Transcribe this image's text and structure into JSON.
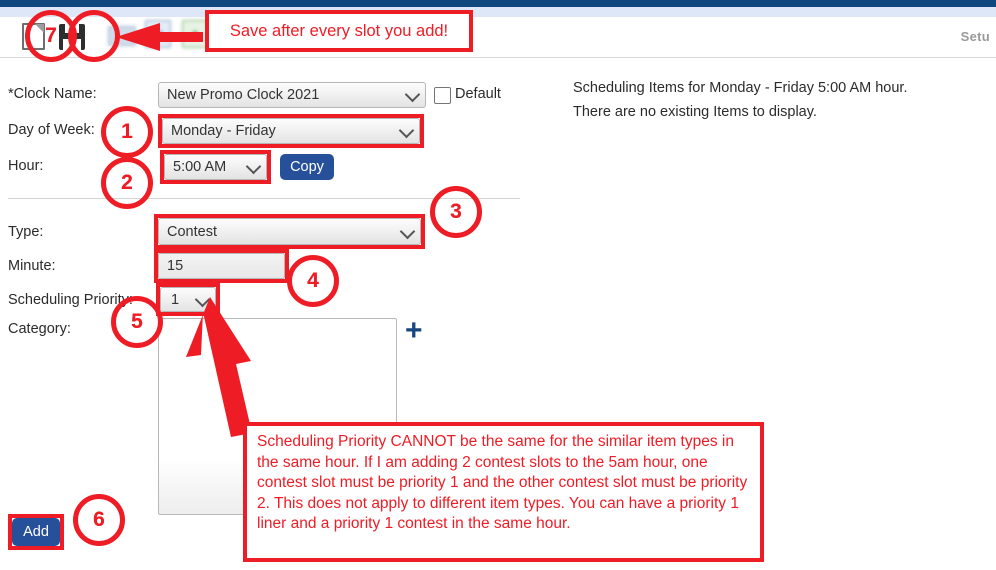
{
  "colors": {
    "navy_bar": "#10477e",
    "light_blue_bar": "#dde7f8",
    "annotation_red": "#ee1c25",
    "button_blue": "#27509b",
    "plus_blue": "#18467f"
  },
  "header": {
    "setup_label": "Setu",
    "toolbar": [
      {
        "name": "new-document-icon",
        "label": "New"
      },
      {
        "name": "save-icon",
        "label": "Save"
      },
      {
        "name": "print-icon",
        "label": "Print"
      },
      {
        "name": "export-word-icon",
        "label": "W"
      },
      {
        "name": "export-excel-icon",
        "label": "X"
      }
    ]
  },
  "form": {
    "clock_name": {
      "label": "*Clock Name:",
      "value": "New Promo Clock 2021"
    },
    "default_checkbox": {
      "label": "Default",
      "checked": false
    },
    "day_of_week": {
      "label": "Day of Week:",
      "value": "Monday - Friday"
    },
    "hour": {
      "label": "Hour:",
      "value": "5:00 AM"
    },
    "copy_button": {
      "label": "Copy"
    },
    "type": {
      "label": "Type:",
      "value": "Contest"
    },
    "minute": {
      "label": "Minute:",
      "value": "15"
    },
    "scheduling_priority": {
      "label": "Scheduling Priority:",
      "value": "1"
    },
    "category": {
      "label": "Category:",
      "value": "",
      "add_icon": "+"
    },
    "add_button": {
      "label": "Add"
    }
  },
  "right_panel": {
    "line1": "Scheduling Items for Monday - Friday 5:00 AM hour.",
    "line2": "There are no existing Items to display."
  },
  "annotations": {
    "callout_top": "Save after every slot you add!",
    "callout_priority": "Scheduling Priority CANNOT be the same for the similar item types in the same hour. If I am adding 2 contest slots to the 5am hour, one contest slot must be priority 1 and the other contest slot must be priority 2. This does not apply to different item types. You can have a priority 1 liner and a priority 1 contest in the same hour.",
    "step_numbers": [
      "1",
      "2",
      "3",
      "4",
      "5",
      "6",
      "7"
    ]
  }
}
